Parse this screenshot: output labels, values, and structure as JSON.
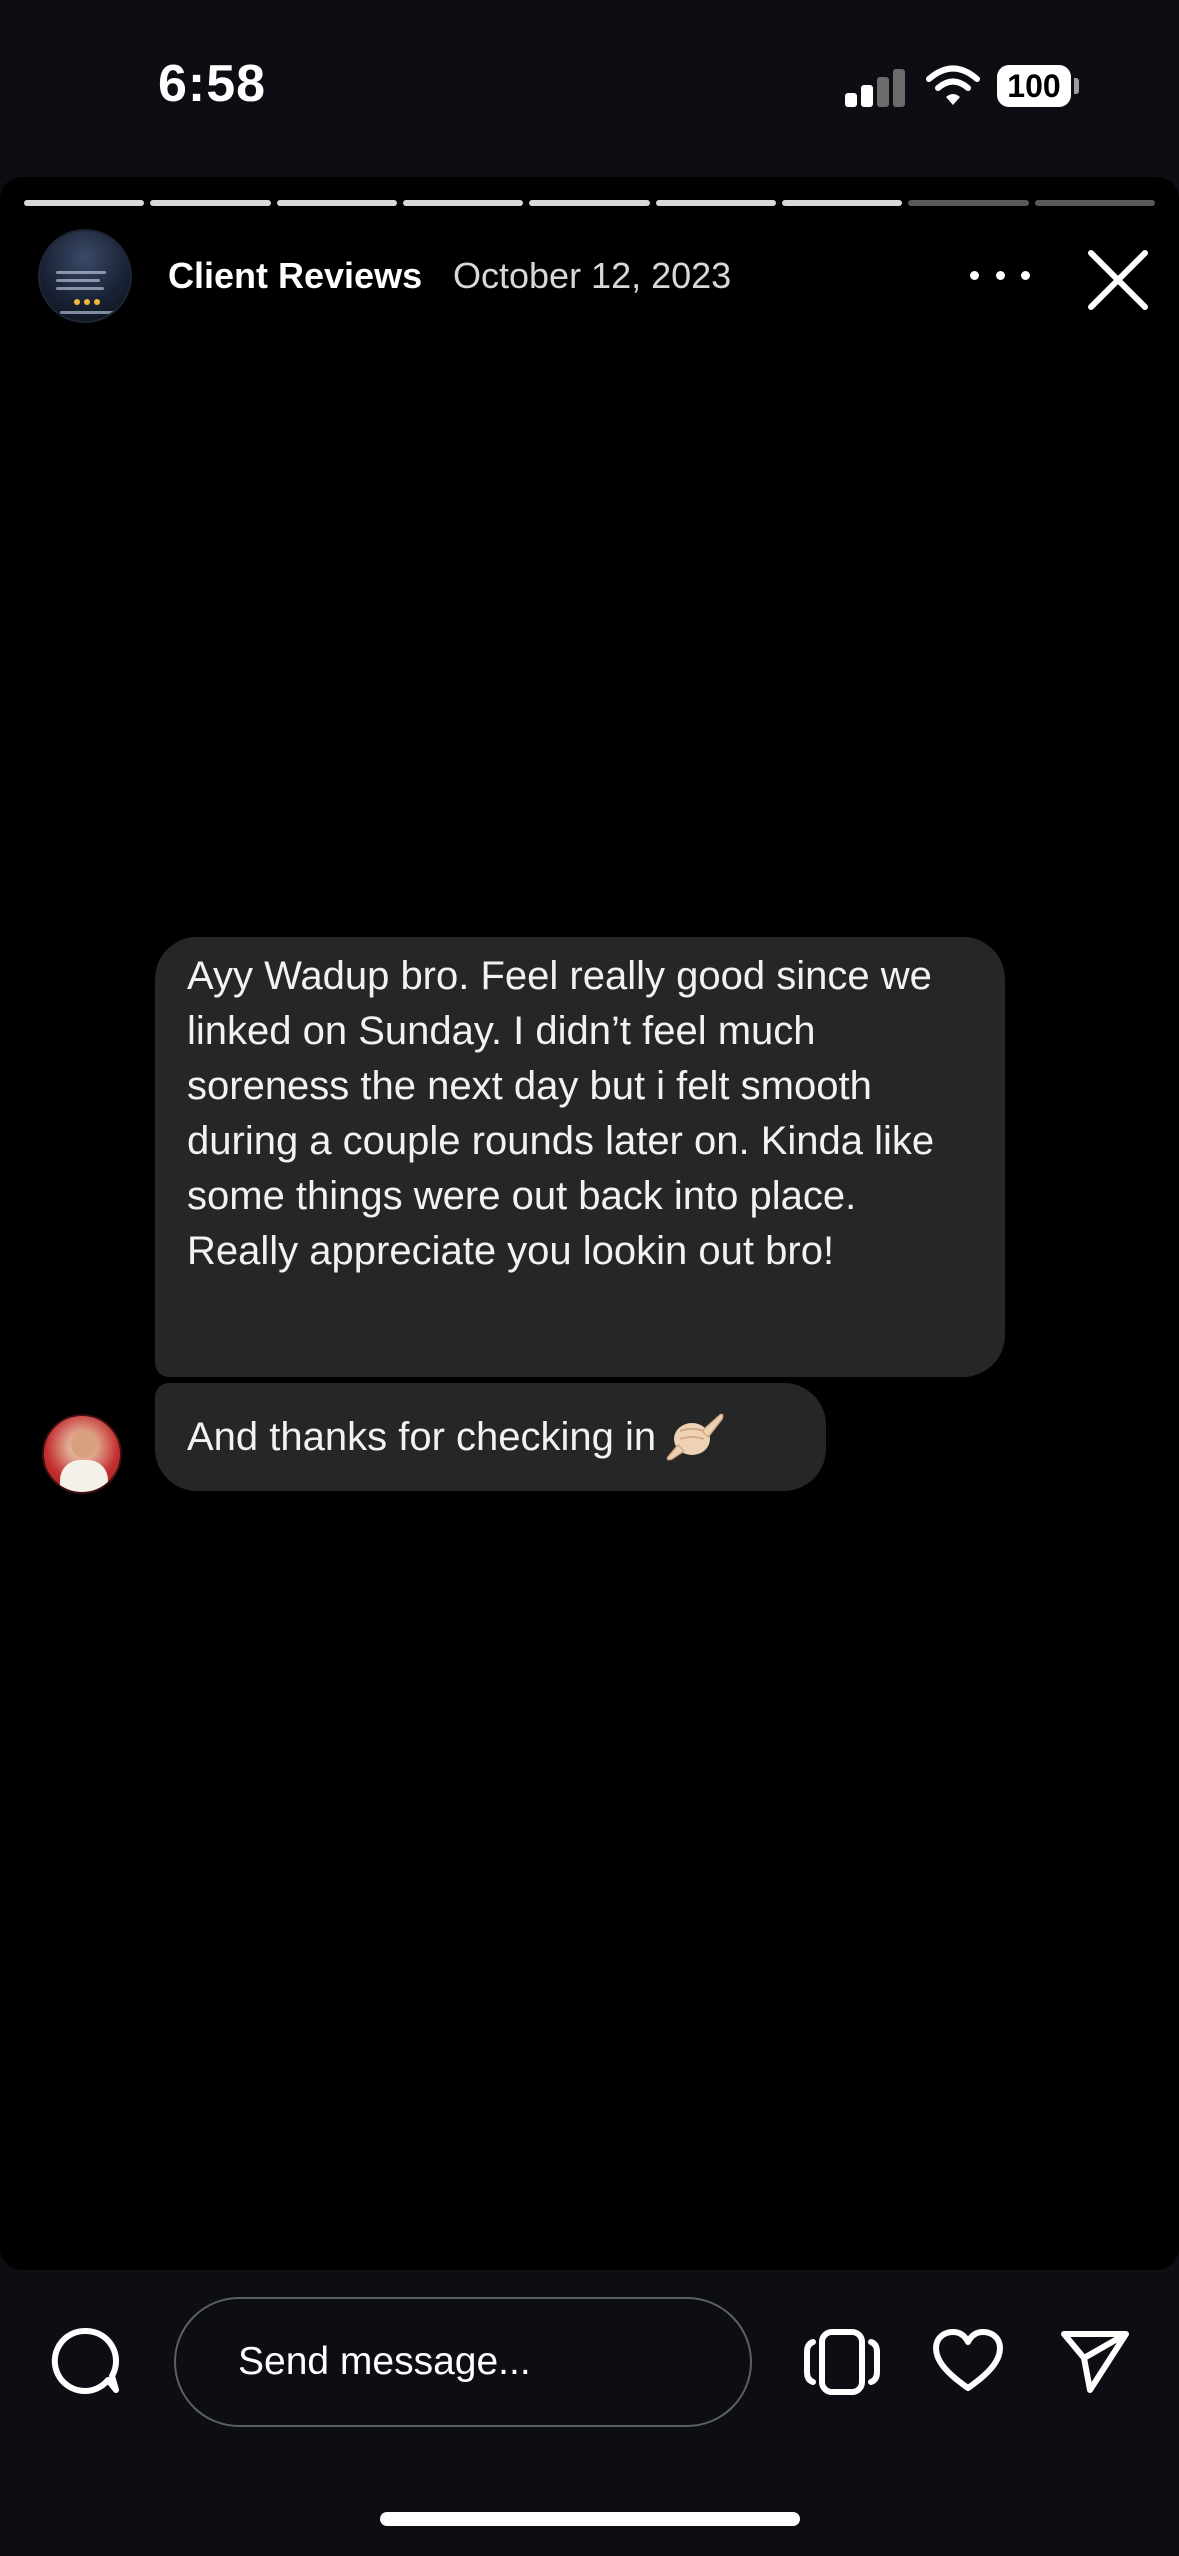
{
  "status_bar": {
    "time": "6:58",
    "battery": "100"
  },
  "story": {
    "progress": {
      "total": 9,
      "current": 8
    },
    "username": "Client Reviews",
    "date": "October 12, 2023"
  },
  "messages": [
    {
      "text": "Ayy Wadup bro. Feel really good since we linked on Sunday. I didn’t feel much soreness the next day but i felt smooth during a couple rounds later on. Kinda like some things were out back into place. Really appreciate you lookin out bro!"
    },
    {
      "text": "And thanks for checking in",
      "emoji": "shaka-icon"
    }
  ],
  "reply": {
    "placeholder": "Send message..."
  },
  "colors": {
    "story_bg": "#000000",
    "bubble": "#262626",
    "app_bg": "#0c0e13"
  }
}
